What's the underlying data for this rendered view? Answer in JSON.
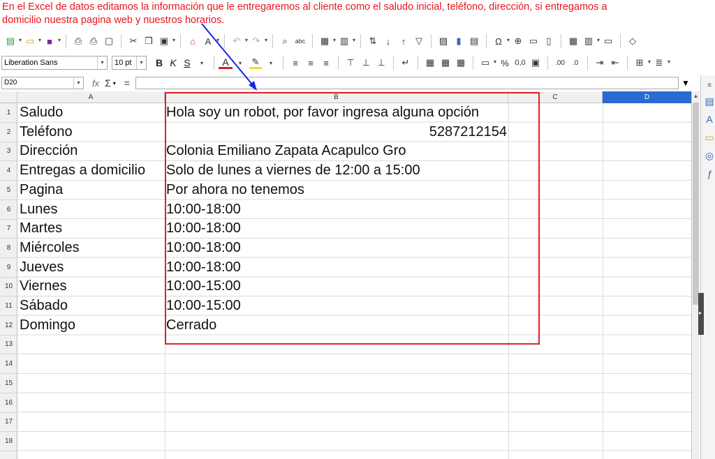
{
  "annotation": {
    "line1": "En el Excel de datos editamos la información que le entregaremos al cliente como el saludo inicial, teléfono, dirección, si entregamos a",
    "line2": "domicilio nuestra pagina web y nuestros horarios.",
    "color": "#e8141b",
    "arrow_color": "#1525e0",
    "highlight_box_color": "#e02020"
  },
  "toolbar": {
    "font_name": "Liberation Sans",
    "font_size": "10 pt",
    "bold": "B",
    "italic": "K",
    "underline": "S",
    "font_color_label": "A",
    "percent": "%",
    "decimal": "0,0",
    "special_char": "Ω"
  },
  "formula_bar": {
    "name_box": "D20",
    "fx": "fx",
    "sum": "Σ",
    "equals": "=",
    "formula": ""
  },
  "columns": [
    "A",
    "B",
    "C",
    "D"
  ],
  "selected_column": "D",
  "rows": [
    "1",
    "2",
    "3",
    "4",
    "5",
    "6",
    "7",
    "8",
    "9",
    "10",
    "11",
    "12",
    "13",
    "14",
    "15",
    "16",
    "17",
    "18"
  ],
  "cells": [
    {
      "a": "Saludo",
      "b": "Hola soy un robot, por favor ingresa alguna opción"
    },
    {
      "a": "Teléfono",
      "b": "5287212154"
    },
    {
      "a": "Dirección",
      "b": "Colonia Emiliano Zapata Acapulco Gro"
    },
    {
      "a": "Entregas a domicilio",
      "b": "Solo de lunes a viernes de 12:00 a 15:00"
    },
    {
      "a": "Pagina",
      "b": "Por ahora no tenemos"
    },
    {
      "a": "Lunes",
      "b": "10:00-18:00"
    },
    {
      "a": "Martes",
      "b": "10:00-18:00"
    },
    {
      "a": "Miércoles",
      "b": "10:00-18:00"
    },
    {
      "a": "Jueves",
      "b": "10:00-18:00"
    },
    {
      "a": "Viernes",
      "b": "10:00-15:00"
    },
    {
      "a": "Sábado",
      "b": "10:00-15:00"
    },
    {
      "a": "Domingo",
      "b": "Cerrado"
    }
  ]
}
